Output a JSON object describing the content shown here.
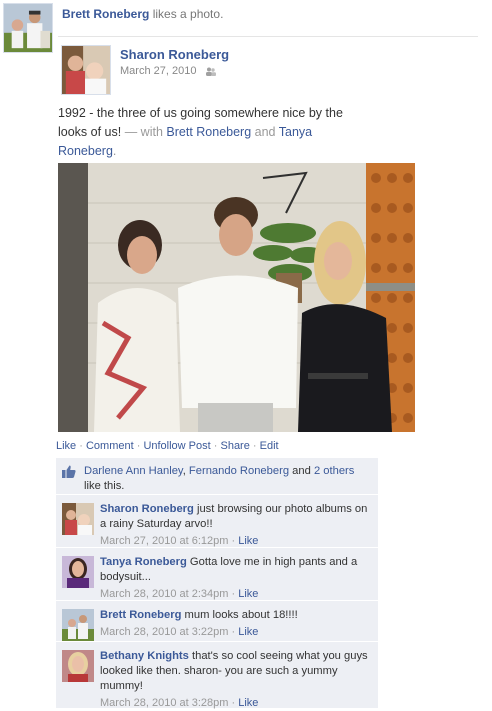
{
  "activity": {
    "actor": "Brett Roneberg",
    "verb": "likes a photo."
  },
  "post": {
    "author": "Sharon Roneberg",
    "date": "March 27, 2010",
    "privacy_icon": "friends-icon",
    "text_main": "1992 - the three of us going somewhere nice by the looks of us!",
    "text_with": " — with ",
    "tag1": "Brett Roneberg",
    "text_and": " and ",
    "tag2": "Tanya Roneberg",
    "text_end": "."
  },
  "actions": {
    "like": "Like",
    "comment": "Comment",
    "unfollow": "Unfollow Post",
    "share": "Share",
    "edit": "Edit",
    "dot": " · "
  },
  "likes": {
    "name1": "Darlene Ann Hanley",
    "comma": ", ",
    "name2": "Fernando Roneberg",
    "and": " and ",
    "others": "2 others",
    "suffix": " like this."
  },
  "comments": [
    {
      "author": "Sharon Roneberg",
      "text": " just browsing our photo albums on a rainy Saturday arvo!!",
      "time": "March 27, 2010 at 6:12pm",
      "like": "Like"
    },
    {
      "author": "Tanya Roneberg",
      "text": " Gotta love me in high pants and a bodysuit...",
      "time": "March 28, 2010 at 2:34pm",
      "like": "Like"
    },
    {
      "author": "Brett Roneberg",
      "text": " mum looks about 18!!!!",
      "time": "March 28, 2010 at 3:22pm",
      "like": "Like"
    },
    {
      "author": "Bethany Knights",
      "text": " that's so cool seeing what you guys looked like then. sharon- you are such a yummy mummy!",
      "time": "March 28, 2010 at 3:28pm",
      "like": "Like"
    }
  ],
  "colors": {
    "link": "#3b5998",
    "ufi_bg": "#edeff4",
    "meta": "#999999"
  }
}
